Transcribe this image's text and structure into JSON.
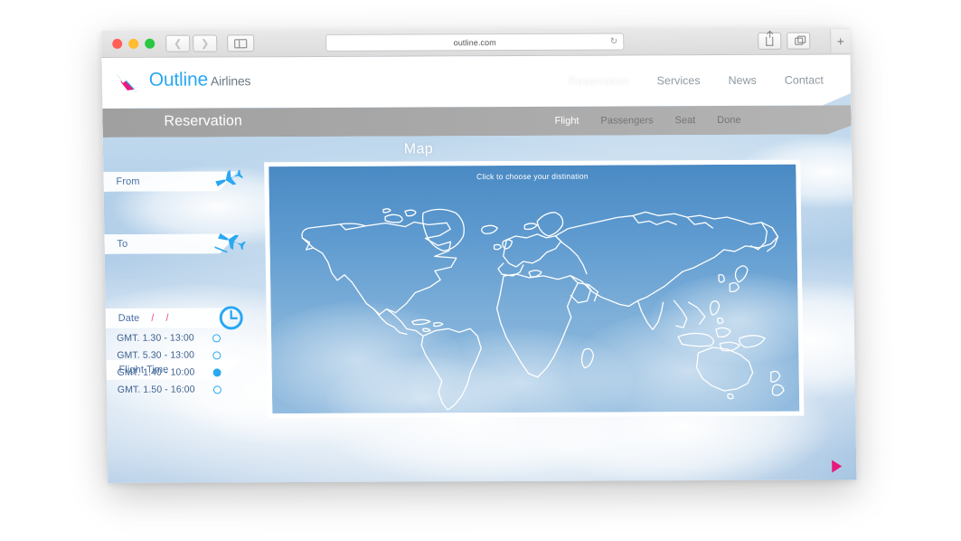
{
  "browser": {
    "url": "outline.com",
    "reload_icon": "reload-icon",
    "back_icon": "chevron-left-icon",
    "forward_icon": "chevron-right-icon",
    "sidebar_icon": "sidebar-icon",
    "share_icon": "share-icon",
    "tabs_icon": "tabs-icon",
    "newtab_label": "+",
    "traffic_lights": [
      {
        "name": "close",
        "color": "#ff5f57"
      },
      {
        "name": "minimize",
        "color": "#febc2e"
      },
      {
        "name": "zoom",
        "color": "#28c840"
      }
    ]
  },
  "site": {
    "brand_main": "Outline",
    "brand_sub": "Airlines",
    "logo_icon": "airline-swoosh-logo",
    "nav": [
      {
        "label": "Reservation",
        "active": true
      },
      {
        "label": "Services",
        "active": false
      },
      {
        "label": "News",
        "active": false
      },
      {
        "label": "Contact",
        "active": false
      }
    ]
  },
  "sub_header": {
    "title": "Reservation",
    "steps": [
      {
        "label": "Flight",
        "active": true
      },
      {
        "label": "Passengers",
        "active": false
      },
      {
        "label": "Seat",
        "active": false
      },
      {
        "label": "Done",
        "active": false
      }
    ]
  },
  "form": {
    "from": {
      "label": "From",
      "value": "",
      "icon": "airplane-takeoff-icon"
    },
    "to": {
      "label": "To",
      "value": "",
      "icon": "airplane-landing-icon"
    },
    "date": {
      "label": "Date",
      "sep1": "/",
      "sep2": "/",
      "value": "",
      "icon": "clock-icon"
    },
    "flight_time": {
      "label": "Flight Time"
    },
    "options": [
      {
        "label": "GMT. 1.30 - 13:00",
        "selected": false
      },
      {
        "label": "GMT. 5.30 - 13:00",
        "selected": false
      },
      {
        "label": "GMT. 1.40 - 10:00",
        "selected": true
      },
      {
        "label": "GMT. 1.50 - 16:00",
        "selected": false
      }
    ]
  },
  "map": {
    "title": "Map",
    "hint": "Click to choose your distination"
  },
  "footer": {
    "play_icon": "play-triangle-icon"
  },
  "colors": {
    "brand_blue": "#2aa8f2",
    "accent_pink": "#e8197d",
    "label_blue": "#4a6fa5",
    "sub_header_gray": "#aaaaaa"
  }
}
